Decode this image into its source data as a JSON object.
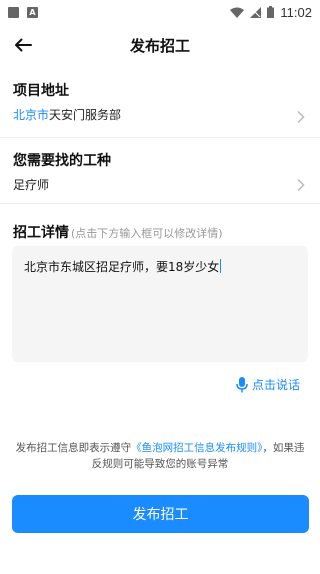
{
  "status": {
    "time": "11:02"
  },
  "header": {
    "title": "发布招工"
  },
  "address": {
    "label": "项目地址",
    "city": "北京市",
    "place": "天安门服务部"
  },
  "job": {
    "label": "您需要找的工种",
    "value": "足疗师"
  },
  "detail": {
    "label": "招工详情",
    "hint": "(点击下方输入框可以修改详情)",
    "text": "北京市东城区招足疗师，要18岁少女"
  },
  "voice": {
    "label": "点击说话"
  },
  "notice": {
    "prefix": "发布招工信息即表示遵守",
    "link": "《鱼泡网招工信息发布规则》",
    "suffix": "，如果违反规则可能导致您的账号异常"
  },
  "submit": {
    "label": "发布招工"
  },
  "colors": {
    "accent": "#1a8cff"
  }
}
